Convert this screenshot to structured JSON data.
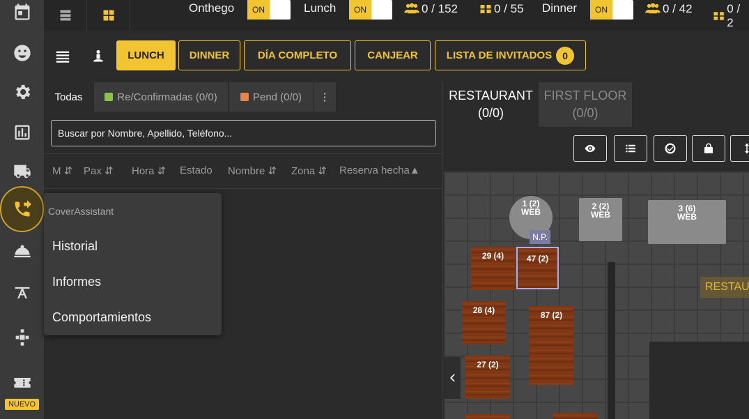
{
  "sidebar": {
    "items": [
      "calendar-icon",
      "face-icon",
      "gear-icon",
      "bar-chart-icon",
      "truck-icon",
      "phone-forward-icon",
      "cloche-icon",
      "lamp-icon",
      "puzzle-icon",
      "ticket-icon"
    ],
    "nuevo_label": "NUEVO"
  },
  "topbar": {
    "onthego_label": "Onthego",
    "onthego_toggle": "ON",
    "lunch_label": "Lunch",
    "lunch_toggle": "ON",
    "lunch_people": "0 / 152",
    "lunch_tables": "0 / 55",
    "dinner_label": "Dinner",
    "dinner_toggle": "ON",
    "dinner_people": "0 / 42",
    "dinner_tables": "0 / 2"
  },
  "toolbar": {
    "lunch": "LUNCH",
    "dinner": "DINNER",
    "dia_completo": "DÍA COMPLETO",
    "canjear": "CANJEAR",
    "lista_invitados": "LISTA DE INVITADOS",
    "invitados_count": "0"
  },
  "filters": {
    "todas": "Todas",
    "confirmadas": "Re/Confirmadas (0/0)",
    "pendientes": "Pend (0/0)",
    "more": "⋮"
  },
  "search": {
    "placeholder": "Buscar por Nombre, Apellido, Teléfono..."
  },
  "columns": [
    "M ⇵",
    "Pax ⇵",
    "Hora ⇵",
    "Estado",
    "Nombre ⇵",
    "Zona ⇵",
    "Reserva hecha▲"
  ],
  "popup": {
    "title": "CoverAssistant",
    "items": [
      "Historial",
      "Informes",
      "Comportamientos"
    ]
  },
  "floor_tabs": [
    {
      "name": "RESTAURANT",
      "count": "(0/0)"
    },
    {
      "name": "FIRST FLOOR",
      "count": "(0/0)"
    }
  ],
  "floor": {
    "zone_label": "RESTAU",
    "np_label": "N.P.",
    "tables": {
      "t1": {
        "label": "1 (2)",
        "source": "WEB"
      },
      "t2": {
        "label": "2 (2)",
        "source": "WEB"
      },
      "t3": {
        "label": "3 (6)",
        "source": "WEB"
      },
      "t29": "29 (4)",
      "t47": "47 (2)",
      "t28": "28 (4)",
      "t87": "87 (2)",
      "t27": "27 (2)"
    }
  },
  "colors": {
    "accent": "#f3c431",
    "confirmed": "#8bc34a",
    "pending": "#e8834a"
  }
}
